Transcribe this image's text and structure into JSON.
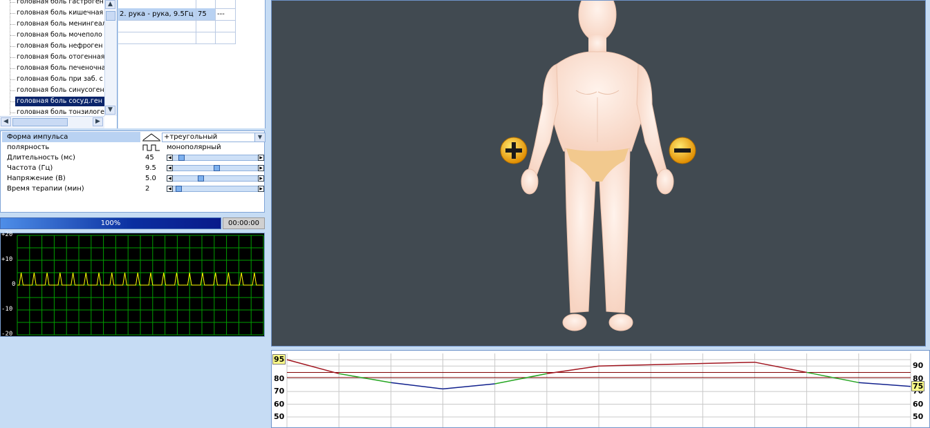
{
  "tree": {
    "items": [
      {
        "label": "головная боль гастроген"
      },
      {
        "label": "головная боль кишечная"
      },
      {
        "label": "головная боль менингеаль"
      },
      {
        "label": "головная боль мочеполо"
      },
      {
        "label": "головная боль нефроген"
      },
      {
        "label": "головная боль отогенная"
      },
      {
        "label": "головная боль печеночна"
      },
      {
        "label": "головная боль при заб. с"
      },
      {
        "label": "головная боль синусоген"
      },
      {
        "label": "головная боль сосуд.ген"
      },
      {
        "label": "головная боль тонзилоге"
      }
    ],
    "selected_index": 9
  },
  "sessions": {
    "rows": [
      {
        "name": "",
        "value": "",
        "extra": ""
      },
      {
        "name": "2. рука - рука, 9.5Гц",
        "value": "75",
        "extra": "---"
      },
      {
        "name": "",
        "value": "",
        "extra": ""
      },
      {
        "name": "",
        "value": "",
        "extra": ""
      }
    ]
  },
  "params": {
    "shape_label": "Форма импульса",
    "shape_value": "+треугольный",
    "polarity_label": "полярность",
    "polarity_value": "монополярный",
    "duration": {
      "label": "Длительность (мс)",
      "value": "45",
      "fraction": 0.05
    },
    "frequency": {
      "label": "Частота (Гц)",
      "value": "9.5",
      "fraction": 0.5
    },
    "voltage": {
      "label": "Напряжение (В)",
      "value": "5.0",
      "fraction": 0.3
    },
    "therapy": {
      "label": "Время терапии (мин)",
      "value": "2",
      "fraction": 0.02
    }
  },
  "progress": {
    "percent_label": "100%",
    "fraction": 1.0,
    "time": "00:00:00"
  },
  "scope": {
    "y_labels": [
      "+20",
      "+10",
      "0",
      "-10",
      "-20"
    ],
    "ymin": -20,
    "ymax": 20,
    "peaks": 19,
    "amplitude": 5
  },
  "electrodes": {
    "plus_icon": "plus-electrode-icon",
    "minus_icon": "minus-electrode-icon"
  },
  "graph": {
    "left_labels": [
      "80",
      "70",
      "60",
      "50"
    ],
    "right_labels": [
      "90",
      "80",
      "70",
      "60",
      "50"
    ],
    "left_badge": "95",
    "right_badge": "75",
    "points": [
      95,
      84,
      77,
      72,
      76,
      84,
      90,
      91,
      92,
      93,
      85,
      77,
      74
    ],
    "threshold_hi": 85,
    "threshold_lo": 81,
    "colors": {
      "high": "#a0141e",
      "mid": "#22a51e",
      "low": "#0f1f8c",
      "ref": "#800000"
    }
  },
  "colors": {
    "scope_grid": "#00a000",
    "scope_trace": "#ffff00",
    "body_bg": "#414a51"
  }
}
